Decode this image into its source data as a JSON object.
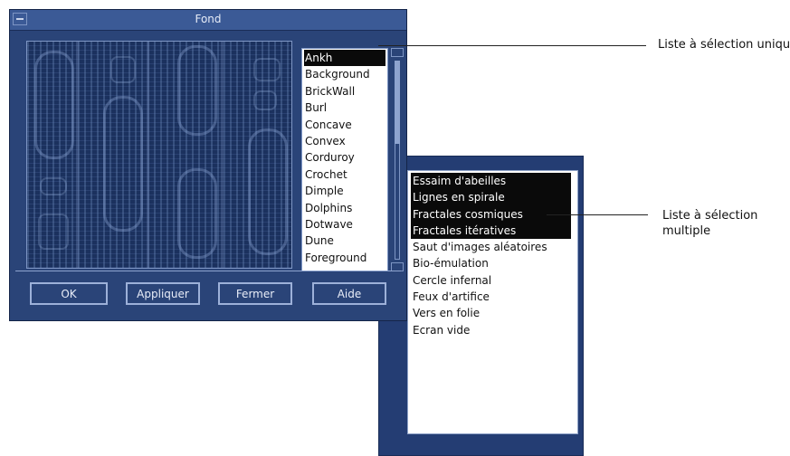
{
  "dialog": {
    "title": "Fond",
    "single_list_items": [
      "Ankh",
      "Background",
      "BrickWall",
      "Burl",
      "Concave",
      "Convex",
      "Corduroy",
      "Crochet",
      "Dimple",
      "Dolphins",
      "Dotwave",
      "Dune",
      "Foreground"
    ],
    "single_list_selected": "Ankh",
    "buttons": {
      "ok": "OK",
      "apply": "Appliquer",
      "close": "Fermer",
      "help": "Aide"
    }
  },
  "multi_list": {
    "items": [
      {
        "label": "Essaim d'abeilles",
        "selected": true
      },
      {
        "label": "Lignes en spirale",
        "selected": true
      },
      {
        "label": "Fractales cosmiques",
        "selected": true
      },
      {
        "label": "Fractales itératives",
        "selected": true
      },
      {
        "label": "Saut d'images aléatoires",
        "selected": false
      },
      {
        "label": "Bio-émulation",
        "selected": false
      },
      {
        "label": "Cercle infernal",
        "selected": false
      },
      {
        "label": "Feux d'artifice",
        "selected": false
      },
      {
        "label": "Vers en folie",
        "selected": false
      },
      {
        "label": "Ecran vide",
        "selected": false
      }
    ]
  },
  "annotations": {
    "single": "Liste à sélection unique",
    "multiple": "Liste à sélection multiple"
  },
  "colors": {
    "panel": "#2a4478",
    "selection": "#0a0a0a"
  }
}
